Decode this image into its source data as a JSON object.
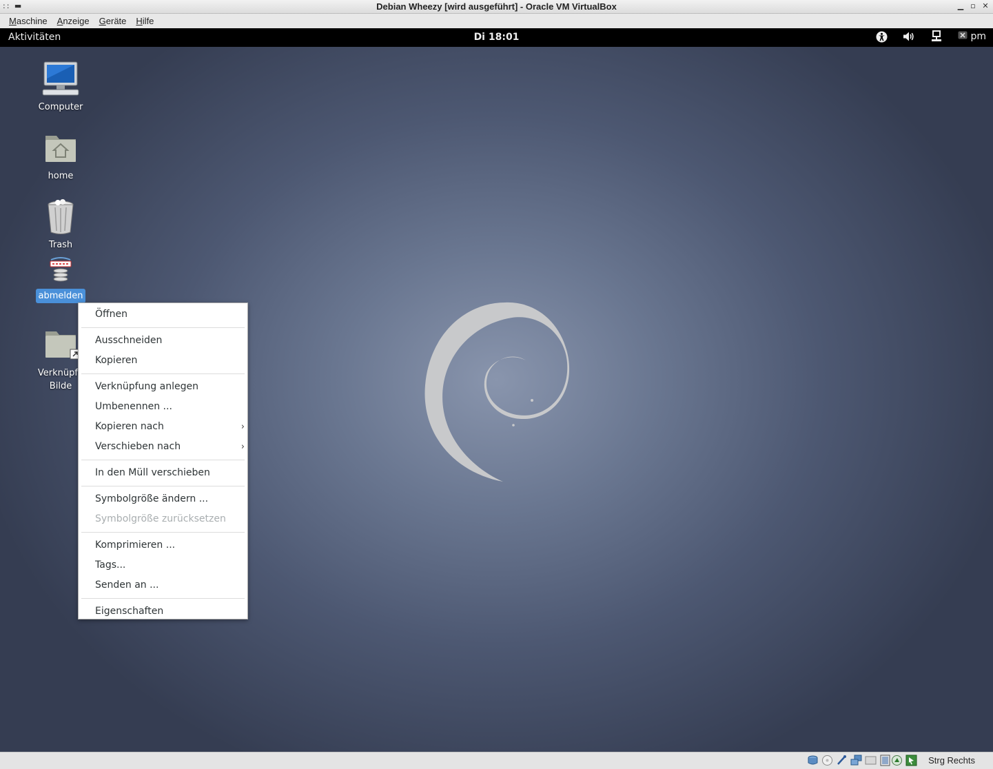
{
  "window": {
    "title": "Debian Wheezy [wird ausgeführt] - Oracle VM VirtualBox",
    "controls": [
      "minimize-icon",
      "maximize-icon",
      "close-icon"
    ]
  },
  "vb_menubar": {
    "items": [
      {
        "label": "Maschine"
      },
      {
        "label": "Anzeige"
      },
      {
        "label": "Geräte"
      },
      {
        "label": "Hilfe"
      }
    ]
  },
  "topbar": {
    "activities": "Aktivitäten",
    "clock": "Di 18:01",
    "tray_icons": [
      "accessibility-icon",
      "volume-icon",
      "network-icon",
      "user-status-icon"
    ],
    "user": "pm"
  },
  "desktop": {
    "icons": [
      {
        "label": "Computer",
        "icon": "computer-icon",
        "selected": false
      },
      {
        "label": "home",
        "icon": "home-folder-icon",
        "selected": false
      },
      {
        "label": "Trash",
        "icon": "trash-icon",
        "selected": false
      },
      {
        "label": "abmelden",
        "icon": "logout-script-icon",
        "selected": true
      },
      {
        "label": "Verknüpfu",
        "label2": "Bilde",
        "icon": "folder-link-icon",
        "selected": false
      }
    ]
  },
  "context_menu": {
    "groups": [
      [
        {
          "label": "Öffnen"
        }
      ],
      [
        {
          "label": "Ausschneiden"
        },
        {
          "label": "Kopieren"
        }
      ],
      [
        {
          "label": "Verknüpfung anlegen"
        },
        {
          "label": "Umbenennen ..."
        },
        {
          "label": "Kopieren nach",
          "submenu": true
        },
        {
          "label": "Verschieben nach",
          "submenu": true
        }
      ],
      [
        {
          "label": "In den Müll verschieben"
        }
      ],
      [
        {
          "label": "Symbolgröße ändern ..."
        },
        {
          "label": "Symbolgröße zurücksetzen",
          "disabled": true
        }
      ],
      [
        {
          "label": "Komprimieren ..."
        },
        {
          "label": "Tags..."
        },
        {
          "label": "Senden an ..."
        }
      ],
      [
        {
          "label": "Eigenschaften"
        }
      ]
    ]
  },
  "vb_status": {
    "icons": [
      "hard-disk-icon",
      "optical-drive-icon",
      "usb-icon",
      "shared-folders-icon",
      "display-icon",
      "video-capture-icon",
      "vt-x-icon",
      "mouse-integration-icon"
    ],
    "host_key": "Strg Rechts"
  },
  "colors": {
    "selection": "#4a90d9",
    "topbar": "#000000",
    "desktop": "#5a6680"
  }
}
